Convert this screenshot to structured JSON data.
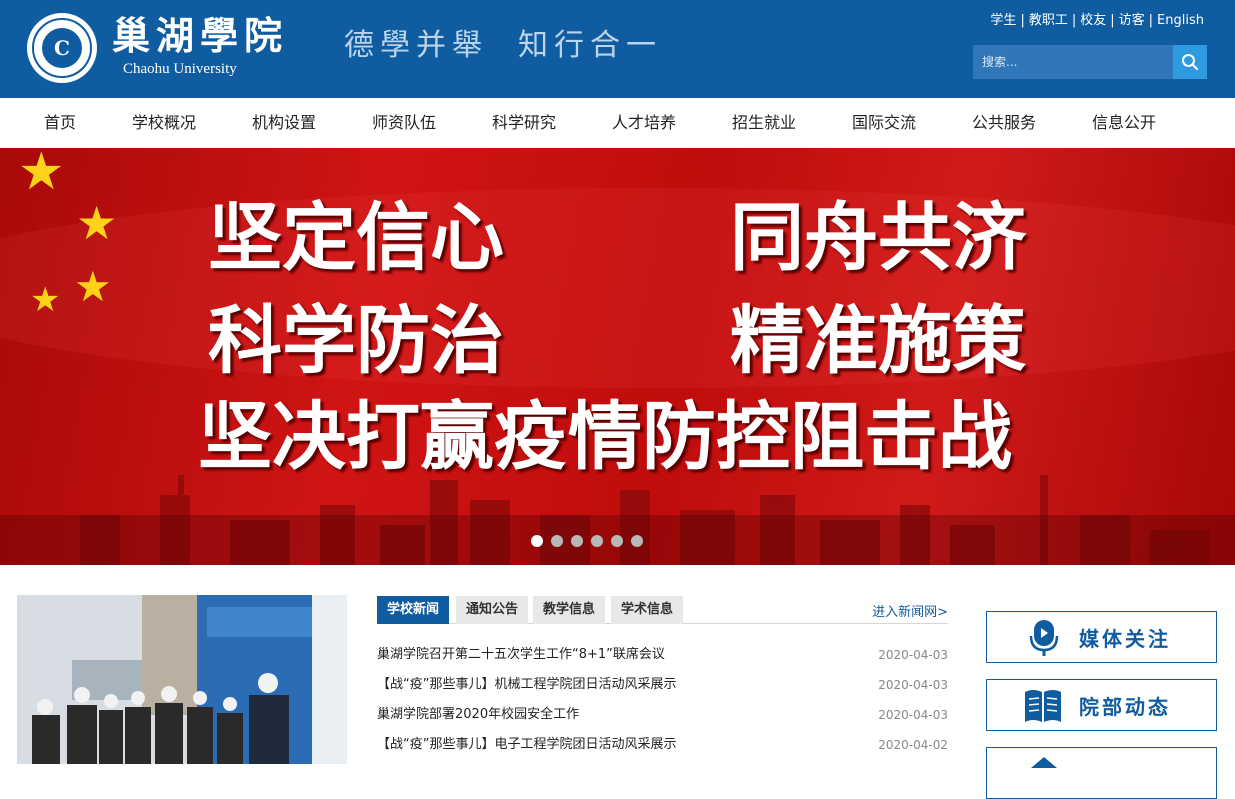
{
  "header": {
    "logo_cn": "巢湖學院",
    "logo_en": "Chaohu University",
    "emblem_letter": "C",
    "motto": [
      "德學并舉",
      "知行合一"
    ],
    "top_links": [
      "学生",
      "教职工",
      "校友",
      "访客",
      "English"
    ],
    "search_placeholder": "搜索..."
  },
  "nav": [
    "首页",
    "学校概况",
    "机构设置",
    "师资队伍",
    "科学研究",
    "人才培养",
    "招生就业",
    "国际交流",
    "公共服务",
    "信息公开"
  ],
  "banner": {
    "line1_left": "坚定信心",
    "line1_right": "同舟共济",
    "line2_left": "科学防治",
    "line2_right": "精准施策",
    "line3": "坚决打赢疫情防控阻击战",
    "slide_count": 6,
    "active_slide": 1
  },
  "news": {
    "tabs": [
      "学校新闻",
      "通知公告",
      "教学信息",
      "学术信息"
    ],
    "more_label": "进入新闻网>",
    "items": [
      {
        "title": "巢湖学院召开第二十五次学生工作“8+1”联席会议",
        "date": "2020-04-03"
      },
      {
        "title": "【战“疫”那些事儿】机械工程学院团日活动风采展示",
        "date": "2020-04-03"
      },
      {
        "title": "巢湖学院部署2020年校园安全工作",
        "date": "2020-04-03"
      },
      {
        "title": "【战“疫”那些事儿】电子工程学院团日活动风采展示",
        "date": "2020-04-02"
      }
    ]
  },
  "side": {
    "media_label": "媒体关注",
    "dept_label": "院部动态"
  },
  "colors": {
    "primary": "#0f5ca0",
    "banner_red": "#c80f0f",
    "search_button": "#2e9be0"
  }
}
